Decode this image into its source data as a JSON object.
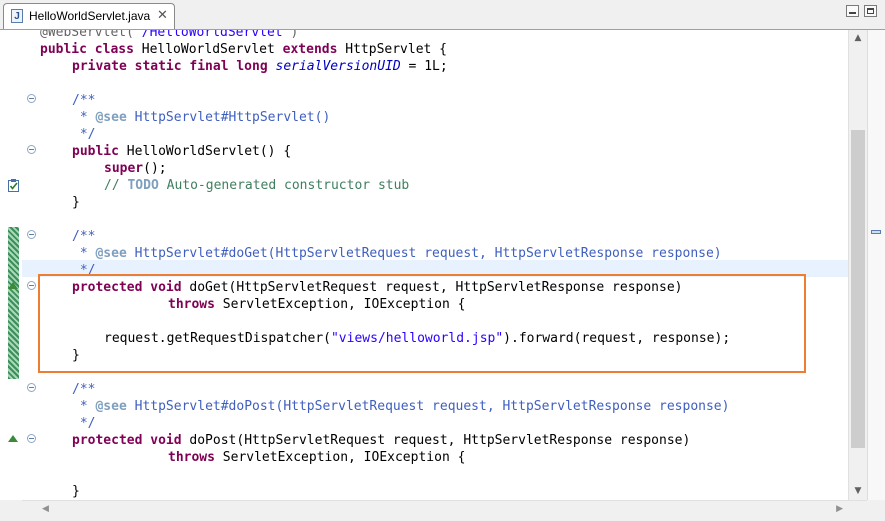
{
  "tab": {
    "title": "HelloWorldServlet.java",
    "icon": "java-file-icon",
    "close_glyph": "✕"
  },
  "window_buttons": [
    "minimize-icon",
    "maximize-icon"
  ],
  "code": {
    "l0_ann": "@WebServlet(",
    "l0_str": "\"/HelloWorldServlet\"",
    "l0_end": ")",
    "l1_kw1": "public class",
    "l1_t1": " HelloWorldServlet ",
    "l1_kw2": "extends",
    "l1_t2": " HttpServlet {",
    "l2_kw": "private static final long",
    "l2_field": "serialVersionUID",
    "l2_t": " = 1L;",
    "l4": "/**",
    "l5_pre": " * ",
    "l5_tag": "@see",
    "l5_rest": " HttpServlet#HttpServlet()",
    "l6": " */",
    "l7_kw": "public",
    "l7_t": " HelloWorldServlet() {",
    "l8_kw": "super",
    "l8_t": "();",
    "l9_pre": "// ",
    "l9_todo": "TODO",
    "l9_rest": " Auto-generated constructor stub",
    "l10": "}",
    "l12": "/**",
    "l13_pre": " * ",
    "l13_tag": "@see",
    "l13_rest": " HttpServlet#doGet(HttpServletRequest request, HttpServletResponse response)",
    "l14": " */",
    "l15_kw": "protected void",
    "l15_t": " doGet(HttpServletRequest request, HttpServletResponse response)",
    "l16_kw": "throws",
    "l16_t": " ServletException, IOException {",
    "l18_t1": "request.getRequestDispatcher(",
    "l18_str": "\"views/helloworld.jsp\"",
    "l18_t2": ").forward(request, response);",
    "l19": "}",
    "l21": "/**",
    "l22_pre": " * ",
    "l22_tag": "@see",
    "l22_rest": " HttpServlet#doPost(HttpServletRequest request, HttpServletResponse response)",
    "l23": " */",
    "l24_kw": "protected void",
    "l24_t": " doPost(HttpServletRequest request, HttpServletResponse response)",
    "l25_kw": "throws",
    "l25_t": " ServletException, IOException {",
    "l27": "}"
  },
  "colors": {
    "keyword": "#7f0055",
    "string": "#2a00ff",
    "javadoc": "#3f5fbf",
    "comment_tag": "#7f9fbf",
    "highlight_border": "#ed7d31",
    "current_line": "#e8f2fe"
  }
}
